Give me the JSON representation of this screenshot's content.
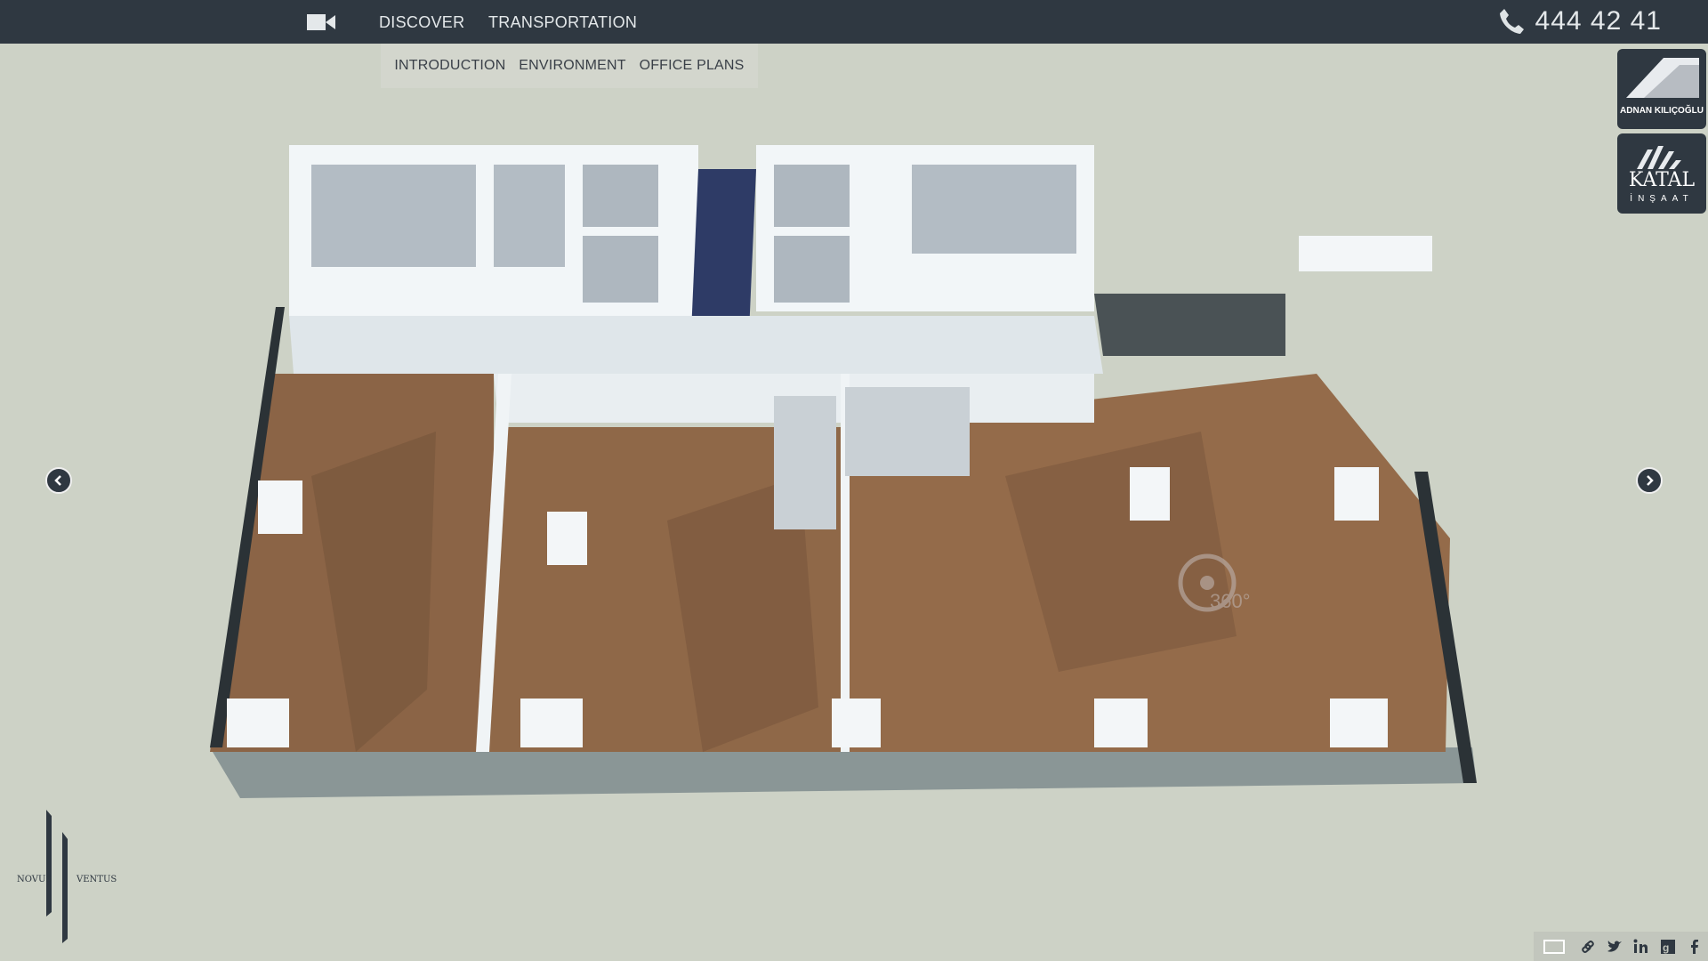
{
  "topbar": {
    "nav": [
      {
        "label": "DISCOVER"
      },
      {
        "label": "TRANSPORTATION"
      }
    ],
    "phone": "444 42 41"
  },
  "submenu": [
    {
      "label": "INTRODUCTION"
    },
    {
      "label": "ENVIRONMENT"
    },
    {
      "label": "OFFICE PLANS"
    }
  ],
  "logos": {
    "adnan": "ADNAN KILIÇOĞLU",
    "katal_main": "KATAL",
    "katal_sub": "İNŞAAT"
  },
  "floorplan": {
    "rotate_badge": "360°"
  },
  "brand": {
    "left": "NOVUS",
    "right": "VENTUS"
  },
  "icons": {
    "video": "video-camera-icon",
    "phone": "phone-icon",
    "prev": "chevron-left-icon",
    "next": "chevron-right-icon",
    "share": [
      "fullscreen-icon",
      "link-icon",
      "twitter-icon",
      "linkedin-icon",
      "google-plus-icon",
      "facebook-icon"
    ]
  },
  "colors": {
    "topbar": "#2f3841",
    "background": "#cdd2c6",
    "floor": "#8b6446",
    "walls": "#e6eaee"
  }
}
